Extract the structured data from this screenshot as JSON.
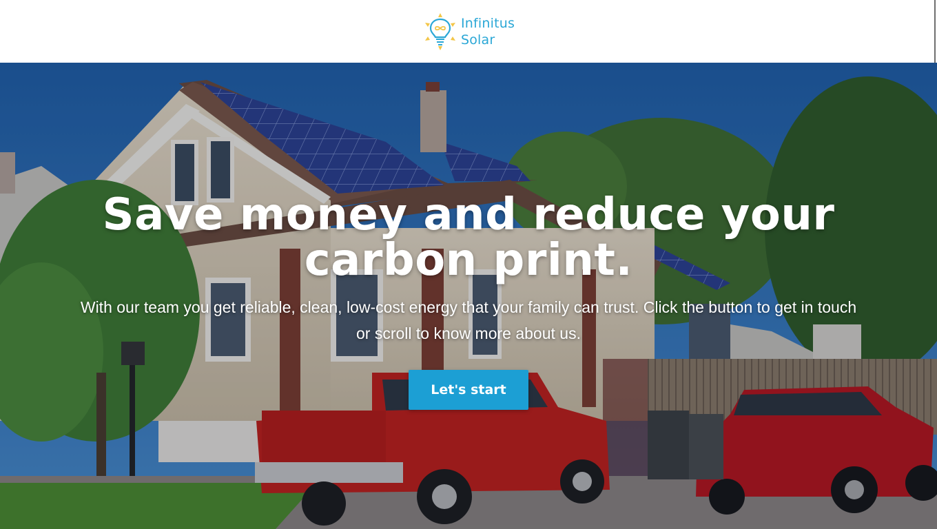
{
  "brand": {
    "line1": "Infinitus",
    "line2": "Solar",
    "icon": "lightbulb-sun-logo",
    "color": "#2aa7d6",
    "accent": "#f3c648"
  },
  "hero": {
    "headline": "Save money and reduce your carbon print.",
    "subline": "With our team you get reliable, clean, low-cost energy that your family can trust. Click the button to get in touch or scroll to know more about us.",
    "cta_label": "Let's start",
    "cta_color": "#1c9fd4",
    "background": "house-with-solar-panels-photo"
  }
}
